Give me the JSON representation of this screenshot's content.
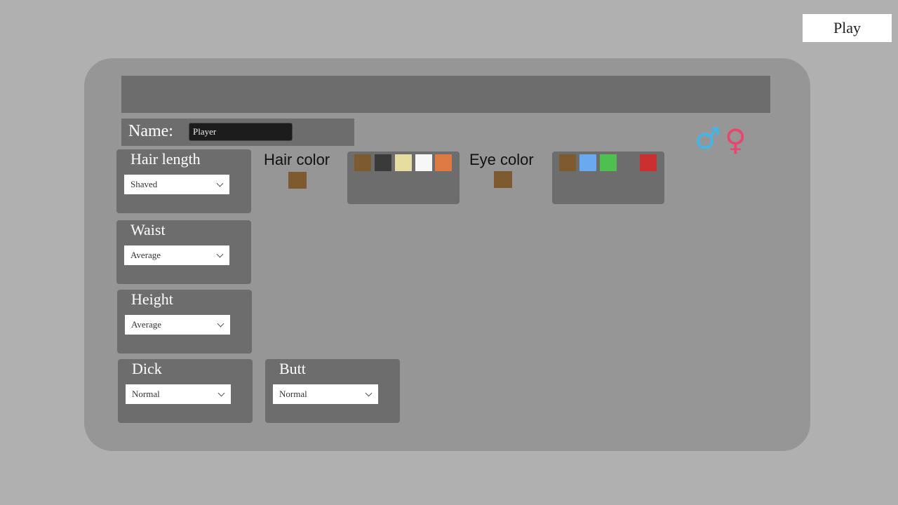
{
  "play_button": {
    "label": "Play"
  },
  "name": {
    "label": "Name:",
    "value": "Player"
  },
  "fields": {
    "hair_length": {
      "label": "Hair length",
      "value": "Shaved"
    },
    "waist": {
      "label": "Waist",
      "value": "Average"
    },
    "height": {
      "label": "Height",
      "value": "Average"
    },
    "dick": {
      "label": "Dick",
      "value": "Normal"
    },
    "butt": {
      "label": "Butt",
      "value": "Normal"
    }
  },
  "hair_color": {
    "label": "Hair color",
    "selected": "#7e5a30",
    "swatches": [
      "#7e5a30",
      "#3a3a3a",
      "#e6dea0",
      "#f7f7f7",
      "#e07a45"
    ]
  },
  "eye_color": {
    "label": "Eye color",
    "selected": "#7e5a30",
    "swatches": [
      "#7e5a30",
      "#6aa9f0",
      "#4fbf4f",
      "#6d6d6d",
      "#cc2f2f"
    ]
  },
  "gender": {
    "male": {
      "icon": "male-symbol-icon",
      "glyph": "♂",
      "color": "#3fb6ea"
    },
    "female": {
      "icon": "female-symbol-icon",
      "glyph": "♀",
      "color": "#e8456f"
    }
  }
}
